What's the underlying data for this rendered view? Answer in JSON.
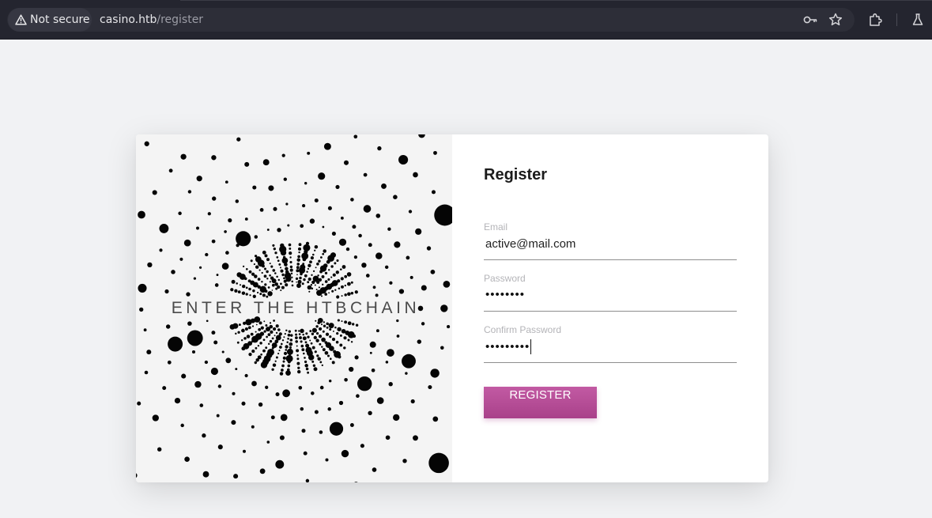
{
  "browser": {
    "security_label": "Not secure",
    "url_host": "casino.htb",
    "url_path": "/register",
    "icons": [
      "warning-icon",
      "key-icon",
      "star-icon",
      "extensions-icon",
      "labs-flask-icon"
    ]
  },
  "hero": {
    "caption": "ENTER THE HTBCHAIN"
  },
  "form": {
    "title": "Register",
    "email": {
      "label": "Email",
      "value": "active@mail.com"
    },
    "password": {
      "label": "Password",
      "masked_value": "••••••••"
    },
    "confirm_password": {
      "label": "Confirm Password",
      "masked_value": "•••••••••"
    },
    "submit_label": "REGISTER"
  },
  "colors": {
    "chrome_bg": "#24252f",
    "page_bg": "#f1f2f4",
    "button_start": "#c25aa3",
    "button_end": "#a9418a"
  }
}
